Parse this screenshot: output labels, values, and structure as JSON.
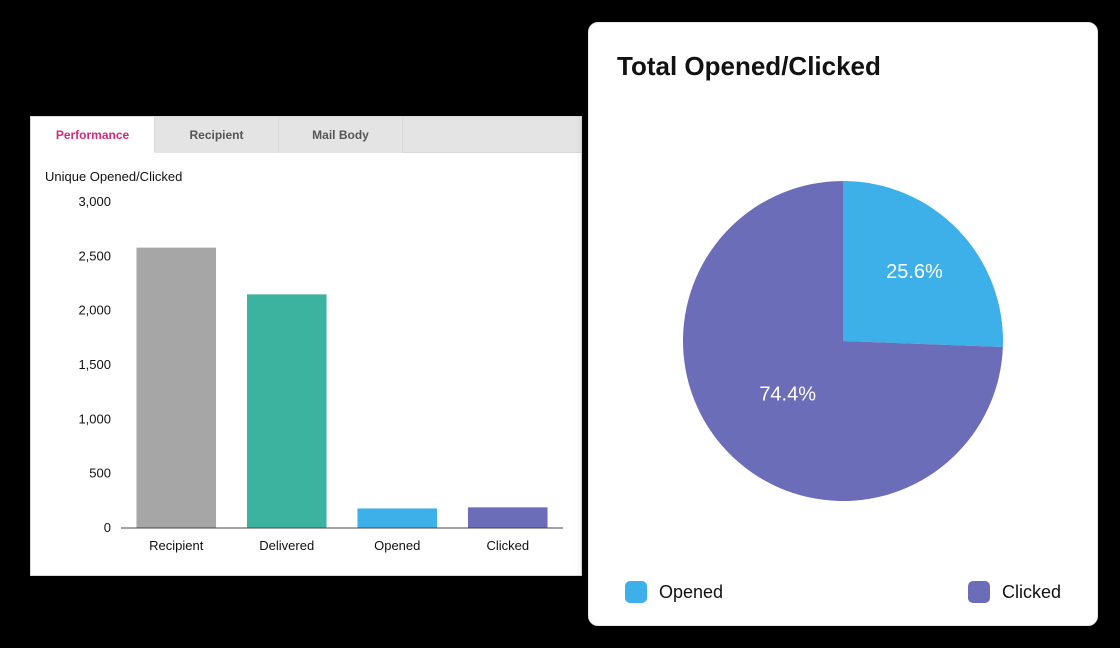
{
  "tabs": [
    {
      "id": "performance",
      "label": "Performance",
      "active": true
    },
    {
      "id": "recipient",
      "label": "Recipient",
      "active": false
    },
    {
      "id": "mailbody",
      "label": "Mail Body",
      "active": false
    }
  ],
  "bar_chart": {
    "title": "Unique Opened/Clicked",
    "y_ticks": [
      "0",
      "500",
      "1,000",
      "1,500",
      "2,000",
      "2,500",
      "3,000"
    ]
  },
  "pie": {
    "title": "Total Opened/Clicked",
    "opened_label": "25.6%",
    "clicked_label": "74.4%",
    "legend": {
      "opened": "Opened",
      "clicked": "Clicked"
    }
  },
  "chart_data": [
    {
      "type": "bar",
      "title": "Unique Opened/Clicked",
      "xlabel": "",
      "ylabel": "",
      "ylim": [
        0,
        3000
      ],
      "categories": [
        "Recipient",
        "Delivered",
        "Opened",
        "Clicked"
      ],
      "values": [
        2580,
        2150,
        180,
        190
      ],
      "colors": [
        "#a6a6a6",
        "#3bb39e",
        "#3dafe9",
        "#6c6db8"
      ]
    },
    {
      "type": "pie",
      "title": "Total Opened/Clicked",
      "series": [
        {
          "name": "Opened",
          "value": 25.6,
          "color": "#3dafe9"
        },
        {
          "name": "Clicked",
          "value": 74.4,
          "color": "#6c6db8"
        }
      ]
    }
  ]
}
